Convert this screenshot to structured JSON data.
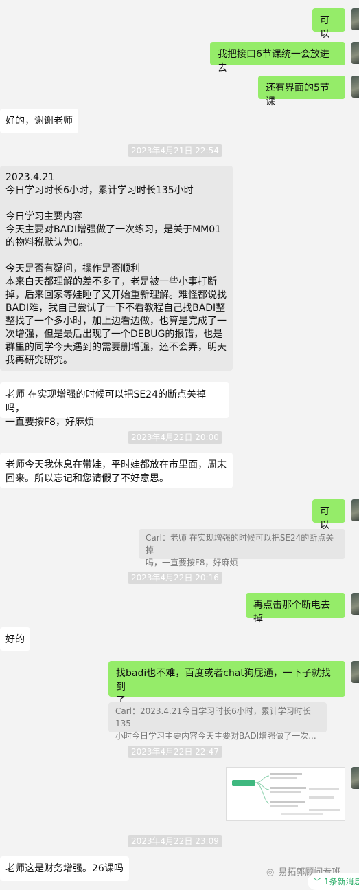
{
  "messages": {
    "m1": "可以",
    "m2": "我把接口6节课统一会放进去",
    "m3": "还有界面的5节课",
    "m4": "好的，谢谢老师",
    "t1": "2023年4月21日 22:54",
    "m5": "2023.4.21\n今日学习时长6小时，累计学习时长135小时\n\n今日学习主要内容\n今天主要对BADI增强做了一次练习，是关于MM01\n的物料税默认为0。\n\n今天是否有疑问，操作是否顺利\n本来白天都理解的差不多了，老是被一些小事打断\n掉，后来回家等娃睡了又开始重新理解。难怪都说找\nBADI难，我自己尝试了一下不看教程自己找BADI整\n整找了一个多小时，加上边看边做，也算是完成了一\n次增强，但是最后出现了一个DEBUG的报错，也是\n群里的同学今天遇到的需要删增强，还不会弄，明天\n我再研究研究。",
    "m6": "老师 在实现增强的时候可以把SE24的断点关掉吗，\n一直要按F8，好麻烦",
    "t2": "2023年4月22日 20:00",
    "m7": "老师今天我休息在带娃，平时娃都放在市里面，周末\n回来。所以忘记和您请假了不好意思。",
    "m8": "可以",
    "q1": "Carl：老师 在实现增强的时候可以把SE24的断点关掉\n吗，一直要按F8，好麻烦",
    "t3": "2023年4月22日 20:16",
    "m9": "再点击那个断电去掉",
    "m10": "好的",
    "m11": "找badi也不难，百度或者chat狗屁通，一下子就找到\n了",
    "q2": "Carl：2023.4.21今日学习时长6小时，累计学习时长135\n小时今日学习主要内容今天主要对BADI增强做了一次...",
    "t4": "2023年4月22日 22:47",
    "t5": "2023年4月22日 23:09",
    "m12": "老师这是财务增强。26课吗"
  },
  "watermark": "易拓郭顾问专班",
  "new_message_tip": "1条新消息",
  "colors": {
    "self_bubble": "#95ec69",
    "other_bubble": "#ffffff",
    "background": "#f3f3f3",
    "timestamp_bg": "#dadada",
    "accent_green": "#2aae67"
  }
}
